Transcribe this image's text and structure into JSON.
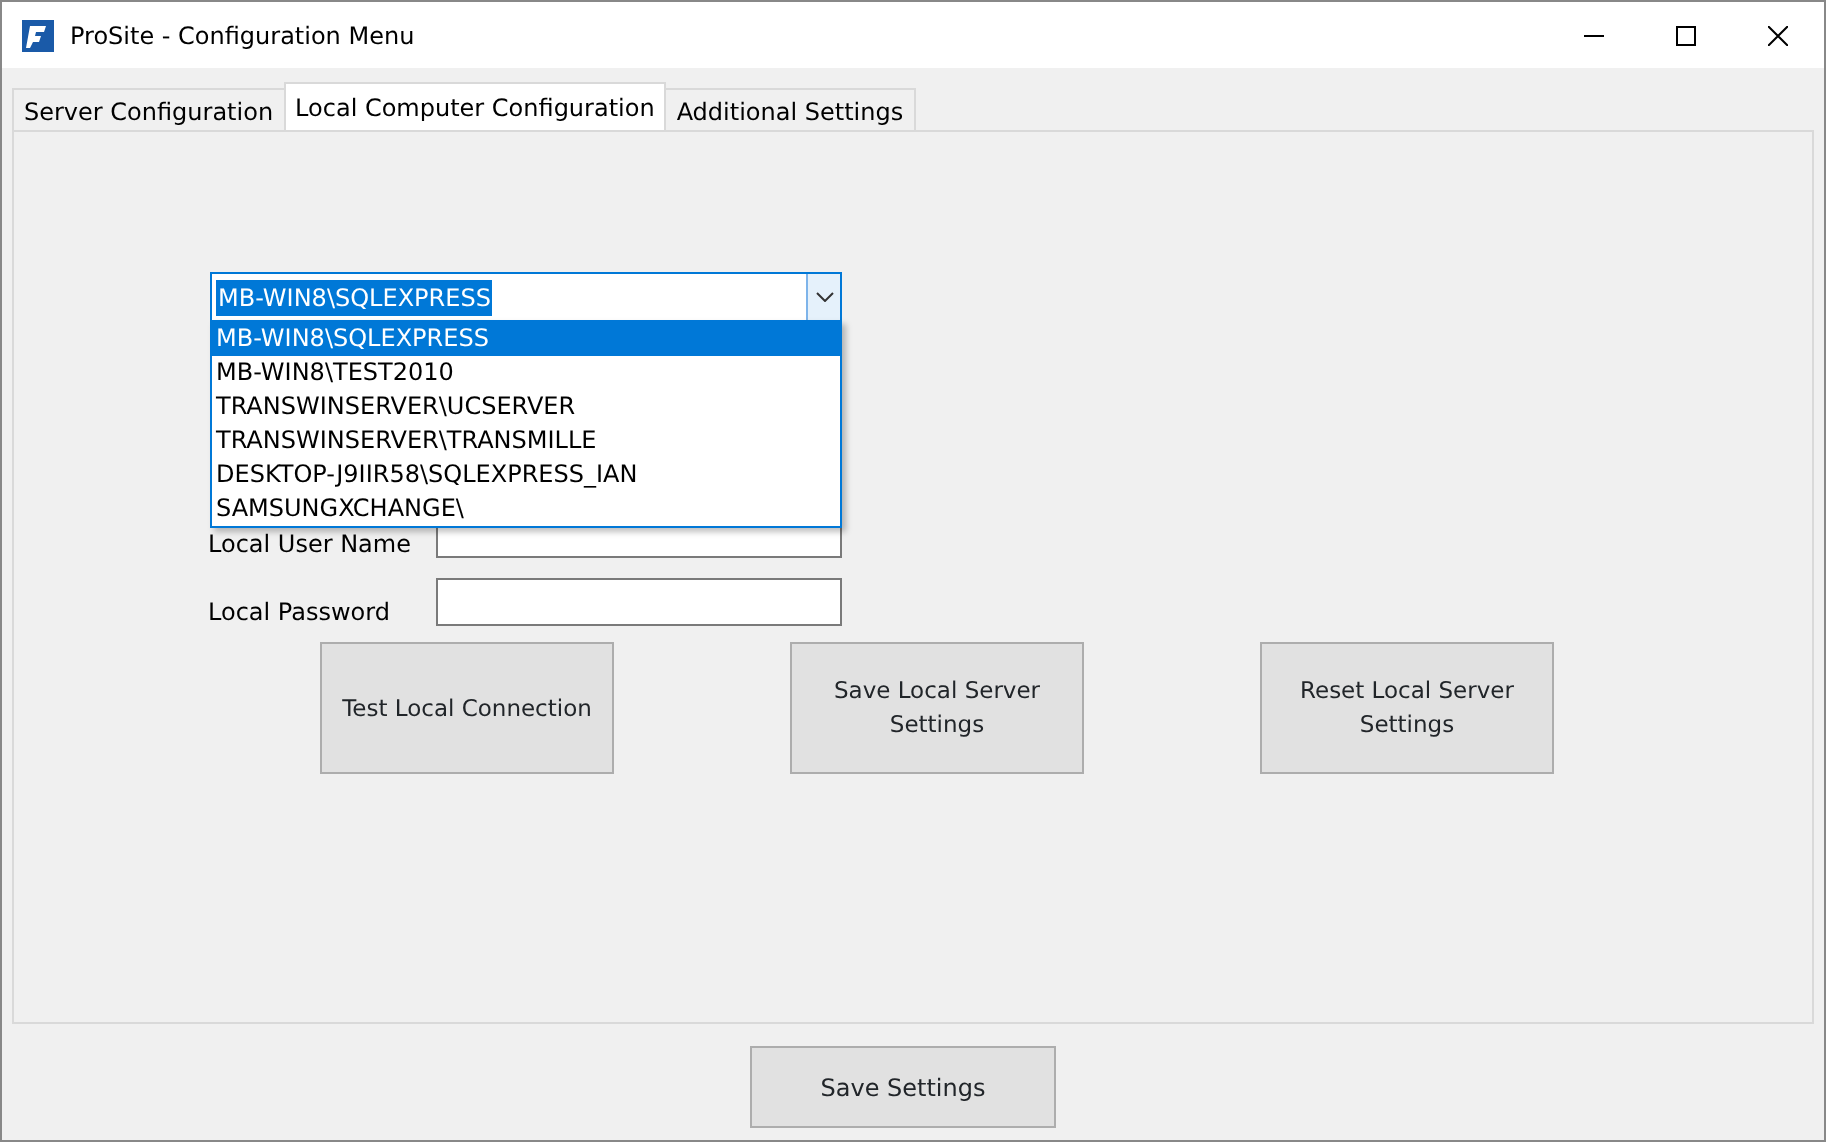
{
  "window": {
    "title": "ProSite - Configuration Menu"
  },
  "tabs": [
    {
      "label": "Server Configuration",
      "selected": false
    },
    {
      "label": "Local Computer Configuration",
      "selected": true
    },
    {
      "label": "Additional Settings",
      "selected": false
    }
  ],
  "server_combo": {
    "value": "MB-WIN8\\SQLEXPRESS",
    "expanded": true,
    "options": [
      {
        "label": "MB-WIN8\\SQLEXPRESS",
        "selected": true
      },
      {
        "label": "MB-WIN8\\TEST2010",
        "selected": false
      },
      {
        "label": "TRANSWINSERVER\\UCSERVER",
        "selected": false
      },
      {
        "label": "TRANSWINSERVER\\TRANSMILLE",
        "selected": false
      },
      {
        "label": "DESKTOP-J9IIR58\\SQLEXPRESS_IAN",
        "selected": false
      },
      {
        "label": "SAMSUNGXCHANGE\\",
        "selected": false
      }
    ]
  },
  "fields": [
    {
      "label": "Local User Name"
    },
    {
      "label": "Local Password"
    }
  ],
  "buttons": [
    "Test Local Connection",
    "Save Local Server Settings",
    "Reset Local Server Settings"
  ],
  "footer_button": "Save Settings"
}
